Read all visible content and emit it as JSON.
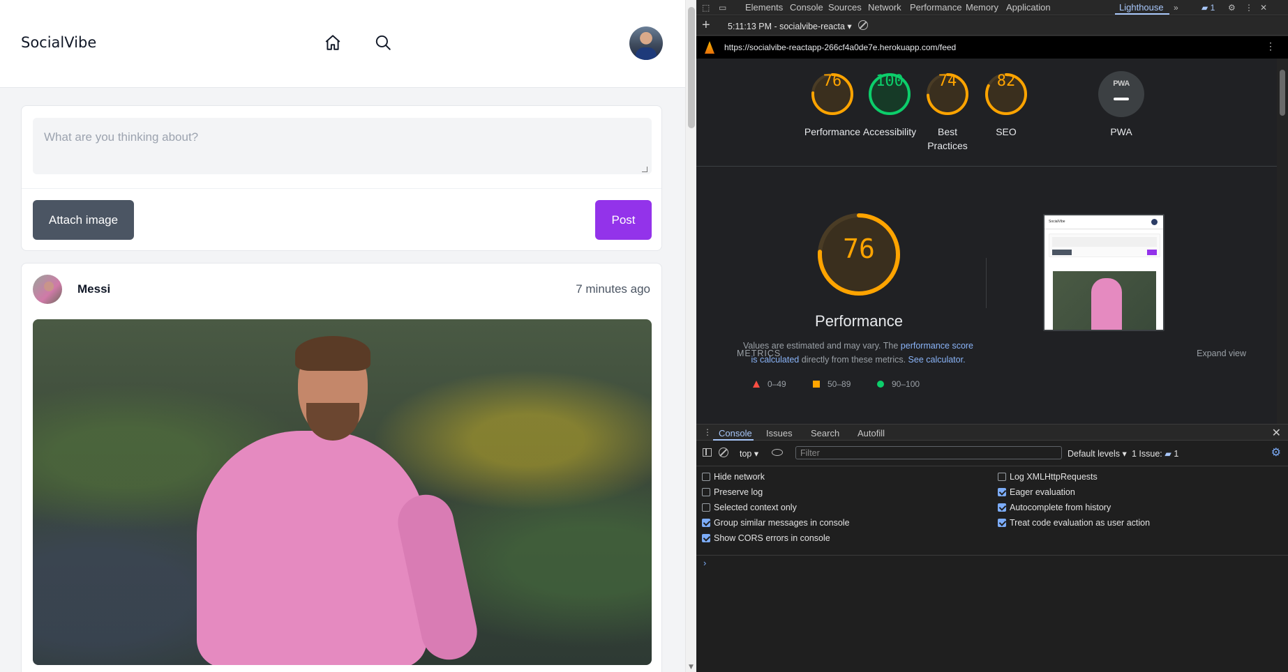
{
  "app": {
    "title": "SocialVibe",
    "composer": {
      "placeholder": "What are you thinking about?",
      "attach_label": "Attach image",
      "post_label": "Post"
    },
    "post": {
      "author": "Messi",
      "time": "7 minutes ago"
    },
    "colors": {
      "post_button": "#9333ea",
      "attach_button": "#4b5563"
    }
  },
  "devtools": {
    "tabs": [
      "Elements",
      "Console",
      "Sources",
      "Network",
      "Performance",
      "Memory",
      "Application",
      "Lighthouse"
    ],
    "active_tab": "Lighthouse",
    "issues_count": "1",
    "lighthouse": {
      "report_select": "5:11:13 PM - socialvibe-reacta",
      "url": "https://socialvibe-reactapp-266cf4a0de7e.herokuapp.com/feed",
      "scores": [
        {
          "label": "Performance",
          "value": "76",
          "color": "#ffa400"
        },
        {
          "label": "Accessibility",
          "value": "100",
          "color": "#0cce6b"
        },
        {
          "label": "Best Practices",
          "value": "74",
          "color": "#ffa400"
        },
        {
          "label": "SEO",
          "value": "82",
          "color": "#ffa400"
        }
      ],
      "pwa": {
        "label": "PWA",
        "badge_text": "PWA"
      },
      "main_gauge": {
        "value": "76",
        "title": "Performance"
      },
      "note": {
        "text1": "Values are estimated and may vary. The ",
        "link1": "performance score is calculated",
        "text2": " directly from these metrics. ",
        "link2": "See calculator."
      },
      "legend": [
        {
          "range": "0–49",
          "shape": "triangle",
          "color": "#ff4e42"
        },
        {
          "range": "50–89",
          "shape": "square",
          "color": "#ffa400"
        },
        {
          "range": "90–100",
          "shape": "circle",
          "color": "#0cce6b"
        }
      ],
      "thumbnail": {
        "title": "SocialVibe"
      },
      "metrics_label": "METRICS",
      "expand_label": "Expand view"
    },
    "drawer": {
      "tabs": [
        "Console",
        "Issues",
        "Search",
        "Autofill"
      ],
      "active_tab": "Console",
      "context": "top",
      "filter_placeholder": "Filter",
      "levels": "Default levels",
      "issues": "1 Issue:",
      "issues_count": "1",
      "settings_left": [
        {
          "label": "Hide network",
          "checked": false
        },
        {
          "label": "Preserve log",
          "checked": false
        },
        {
          "label": "Selected context only",
          "checked": false
        },
        {
          "label": "Group similar messages in console",
          "checked": true
        },
        {
          "label": "Show CORS errors in console",
          "checked": true
        }
      ],
      "settings_right": [
        {
          "label": "Log XMLHttpRequests",
          "checked": false
        },
        {
          "label": "Eager evaluation",
          "checked": true
        },
        {
          "label": "Autocomplete from history",
          "checked": true
        },
        {
          "label": "Treat code evaluation as user action",
          "checked": true
        }
      ]
    }
  }
}
